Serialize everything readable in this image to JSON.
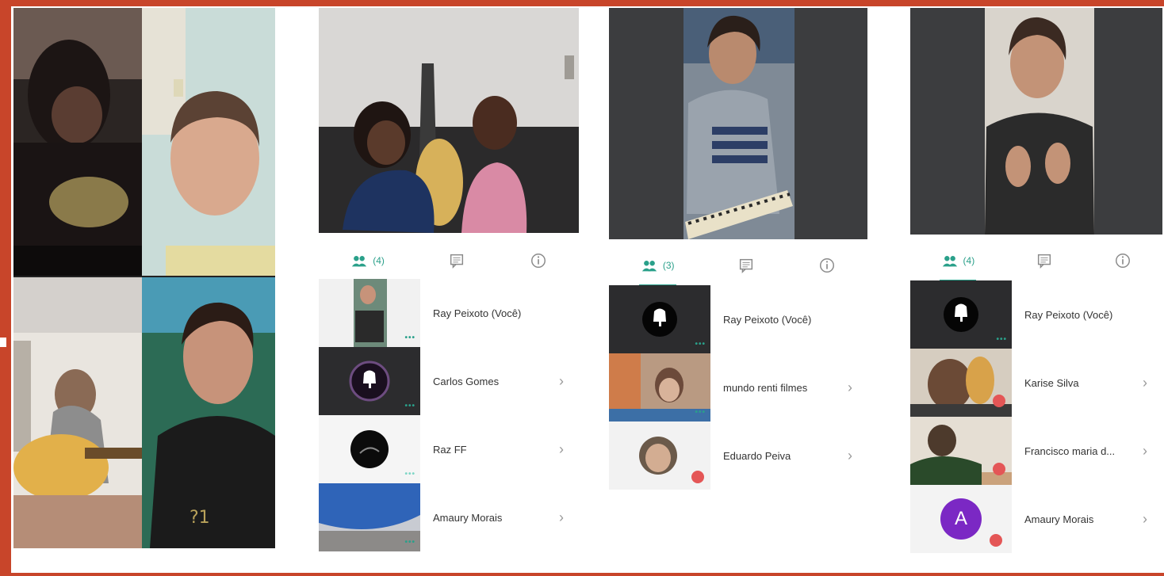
{
  "colors": {
    "frame": "#c8452a",
    "accent": "#2aa08a",
    "stage_bg": "#3c3d3f",
    "mute_badge": "#e45656",
    "avatar_purple": "#7b28c4"
  },
  "tabs": [
    {
      "icon": "participants-icon",
      "label": "(4)"
    },
    {
      "icon": "chat-icon",
      "label": ""
    },
    {
      "icon": "info-icon",
      "label": ""
    }
  ],
  "panels": [
    {
      "tab_count": "(4)",
      "participants": [
        {
          "name": "Ray Peixoto (Você)",
          "chevron": ""
        },
        {
          "name": "Carlos Gomes",
          "chevron": "›"
        },
        {
          "name": "Raz FF",
          "chevron": "›"
        },
        {
          "name": "Amaury Morais",
          "chevron": "›"
        }
      ]
    },
    {
      "tab_count": "(3)",
      "participants": [
        {
          "name": "Ray Peixoto (Você)",
          "chevron": ""
        },
        {
          "name": "mundo renti filmes",
          "chevron": "›"
        },
        {
          "name": "Eduardo Peiva",
          "chevron": "›"
        }
      ]
    },
    {
      "tab_count": "(4)",
      "participants": [
        {
          "name": "Ray Peixoto (Você)",
          "chevron": ""
        },
        {
          "name": "Karise Silva",
          "chevron": "›"
        },
        {
          "name": "Francisco maria d...",
          "chevron": "›"
        },
        {
          "name": "Amaury Morais",
          "chevron": "›",
          "avatar_letter": "A"
        }
      ]
    }
  ]
}
